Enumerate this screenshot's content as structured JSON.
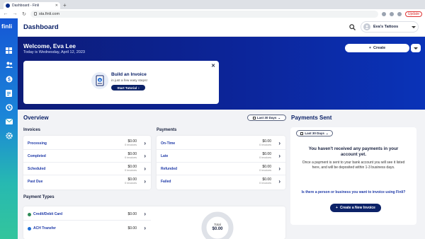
{
  "browser": {
    "tab_title": "Dashboard - Finli",
    "url": "sta.finli.com",
    "update_label": "Update"
  },
  "app": {
    "logo": "finli",
    "sidebar_icons": [
      "dashboard-icon",
      "customers-icon",
      "payments-icon",
      "invoices-icon",
      "recurring-icon",
      "mail-icon",
      "settings-icon"
    ]
  },
  "header": {
    "title": "Dashboard",
    "account_name": "Eva's Tattoos"
  },
  "hero": {
    "welcome": "Welcome, Eva Lee",
    "date_line": "Today is Wednesday, April 12, 2023",
    "create_label": "Create"
  },
  "tutorial_card": {
    "title": "Build an Invoice",
    "subtitle": "in just a few easy steps!",
    "button": "Start Tutorial"
  },
  "overview": {
    "title": "Overview",
    "range_label": "Last 30 Days",
    "invoices": {
      "title": "Invoices",
      "rows": [
        {
          "label": "Processing",
          "amount": "$0.00",
          "count": "0 invoices"
        },
        {
          "label": "Completed",
          "amount": "$0.00",
          "count": "0 invoices"
        },
        {
          "label": "Scheduled",
          "amount": "$0.00",
          "count": "0 invoices"
        },
        {
          "label": "Past Due",
          "amount": "$0.00",
          "count": "0 invoices"
        }
      ]
    },
    "payments": {
      "title": "Payments",
      "rows": [
        {
          "label": "On-Time",
          "amount": "$0.00",
          "count": "0 invoices"
        },
        {
          "label": "Late",
          "amount": "$0.00",
          "count": "0 invoices"
        },
        {
          "label": "Refunded",
          "amount": "$0.00",
          "count": "0 invoices"
        },
        {
          "label": "Failed",
          "amount": "$0.00",
          "count": "0 invoices"
        }
      ]
    },
    "payment_types": {
      "title": "Payment Types",
      "rows": [
        {
          "label": "Credit/Debit Card",
          "amount": "$0.00",
          "color": "#2e8b57"
        },
        {
          "label": "ACH Transfer",
          "amount": "$0.00",
          "color": "#1f6fd6"
        }
      ],
      "total_label": "Total",
      "total_value": "$0.00"
    }
  },
  "payments_sent": {
    "title": "Payments Sent",
    "range_label": "Last 30 Days",
    "empty_title": "You haven't received any payments in your account yet.",
    "empty_body": "Once a payment is sent to your bank account you will see it listed here, and will be deposited within 1-3 business days.",
    "question": "Is there a person or business you want to invoice using Finli?",
    "button": "Create a New Invoice"
  },
  "colors": {
    "brand_navy": "#0c2268",
    "link_blue": "#1f3aa8"
  }
}
